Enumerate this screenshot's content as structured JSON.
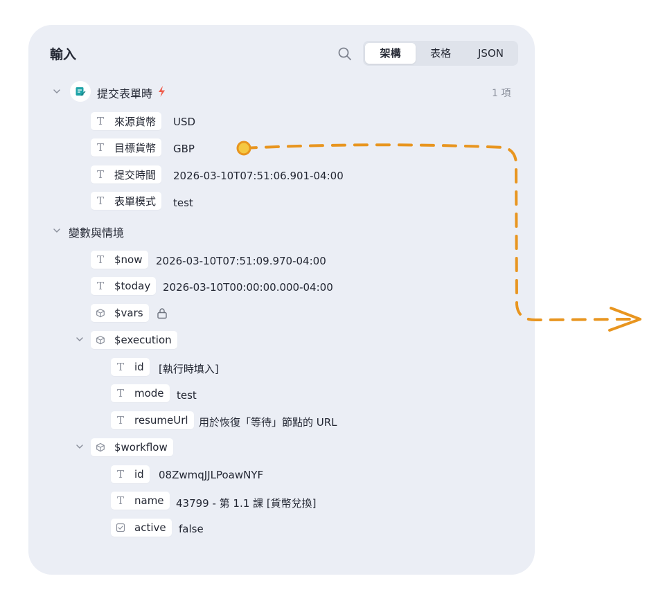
{
  "panel": {
    "title": "輸入",
    "tabs": [
      {
        "label": "架構",
        "active": true
      },
      {
        "label": "表格",
        "active": false
      },
      {
        "label": "JSON",
        "active": false
      }
    ]
  },
  "trigger_node": {
    "name": "提交表單時",
    "item_count": "1 項",
    "fields": [
      {
        "key": "來源貨幣",
        "value": "USD",
        "type": "string"
      },
      {
        "key": "目標貨幣",
        "value": "GBP",
        "type": "string"
      },
      {
        "key": "提交時間",
        "value": "2026-03-10T07:51:06.901-04:00",
        "type": "string"
      },
      {
        "key": "表單模式",
        "value": "test",
        "type": "string"
      }
    ]
  },
  "variables": {
    "title": "變數與情境",
    "now": {
      "key": "$now",
      "value": "2026-03-10T07:51:09.970-04:00"
    },
    "today": {
      "key": "$today",
      "value": "2026-03-10T00:00:00.000-04:00"
    },
    "vars": {
      "key": "$vars"
    },
    "execution": {
      "key": "$execution",
      "fields": [
        {
          "key": "id",
          "value": "[執行時填入]"
        },
        {
          "key": "mode",
          "value": "test"
        },
        {
          "key": "resumeUrl",
          "value": "用於恢復「等待」節點的 URL"
        }
      ]
    },
    "workflow": {
      "key": "$workflow",
      "fields": [
        {
          "key": "id",
          "value": "08ZwmqJJLPoawNYF"
        },
        {
          "key": "name",
          "value": "43799 - 第 1.1 課 [貨幣兌換]"
        },
        {
          "key": "active",
          "value": "false"
        }
      ]
    }
  },
  "icons": {
    "search": "search-icon",
    "string_type": "text-type-icon",
    "object_type": "cube-icon",
    "boolean_type": "checkbox-icon",
    "lock": "lock-icon",
    "trigger_bolt": "lightning-icon",
    "form": "form-icon"
  },
  "colors": {
    "panel_bg": "#ebeef5",
    "annotation_orange": "#e8951f",
    "bolt_red": "#ef5b4a",
    "form_teal": "#1fa4a8"
  }
}
